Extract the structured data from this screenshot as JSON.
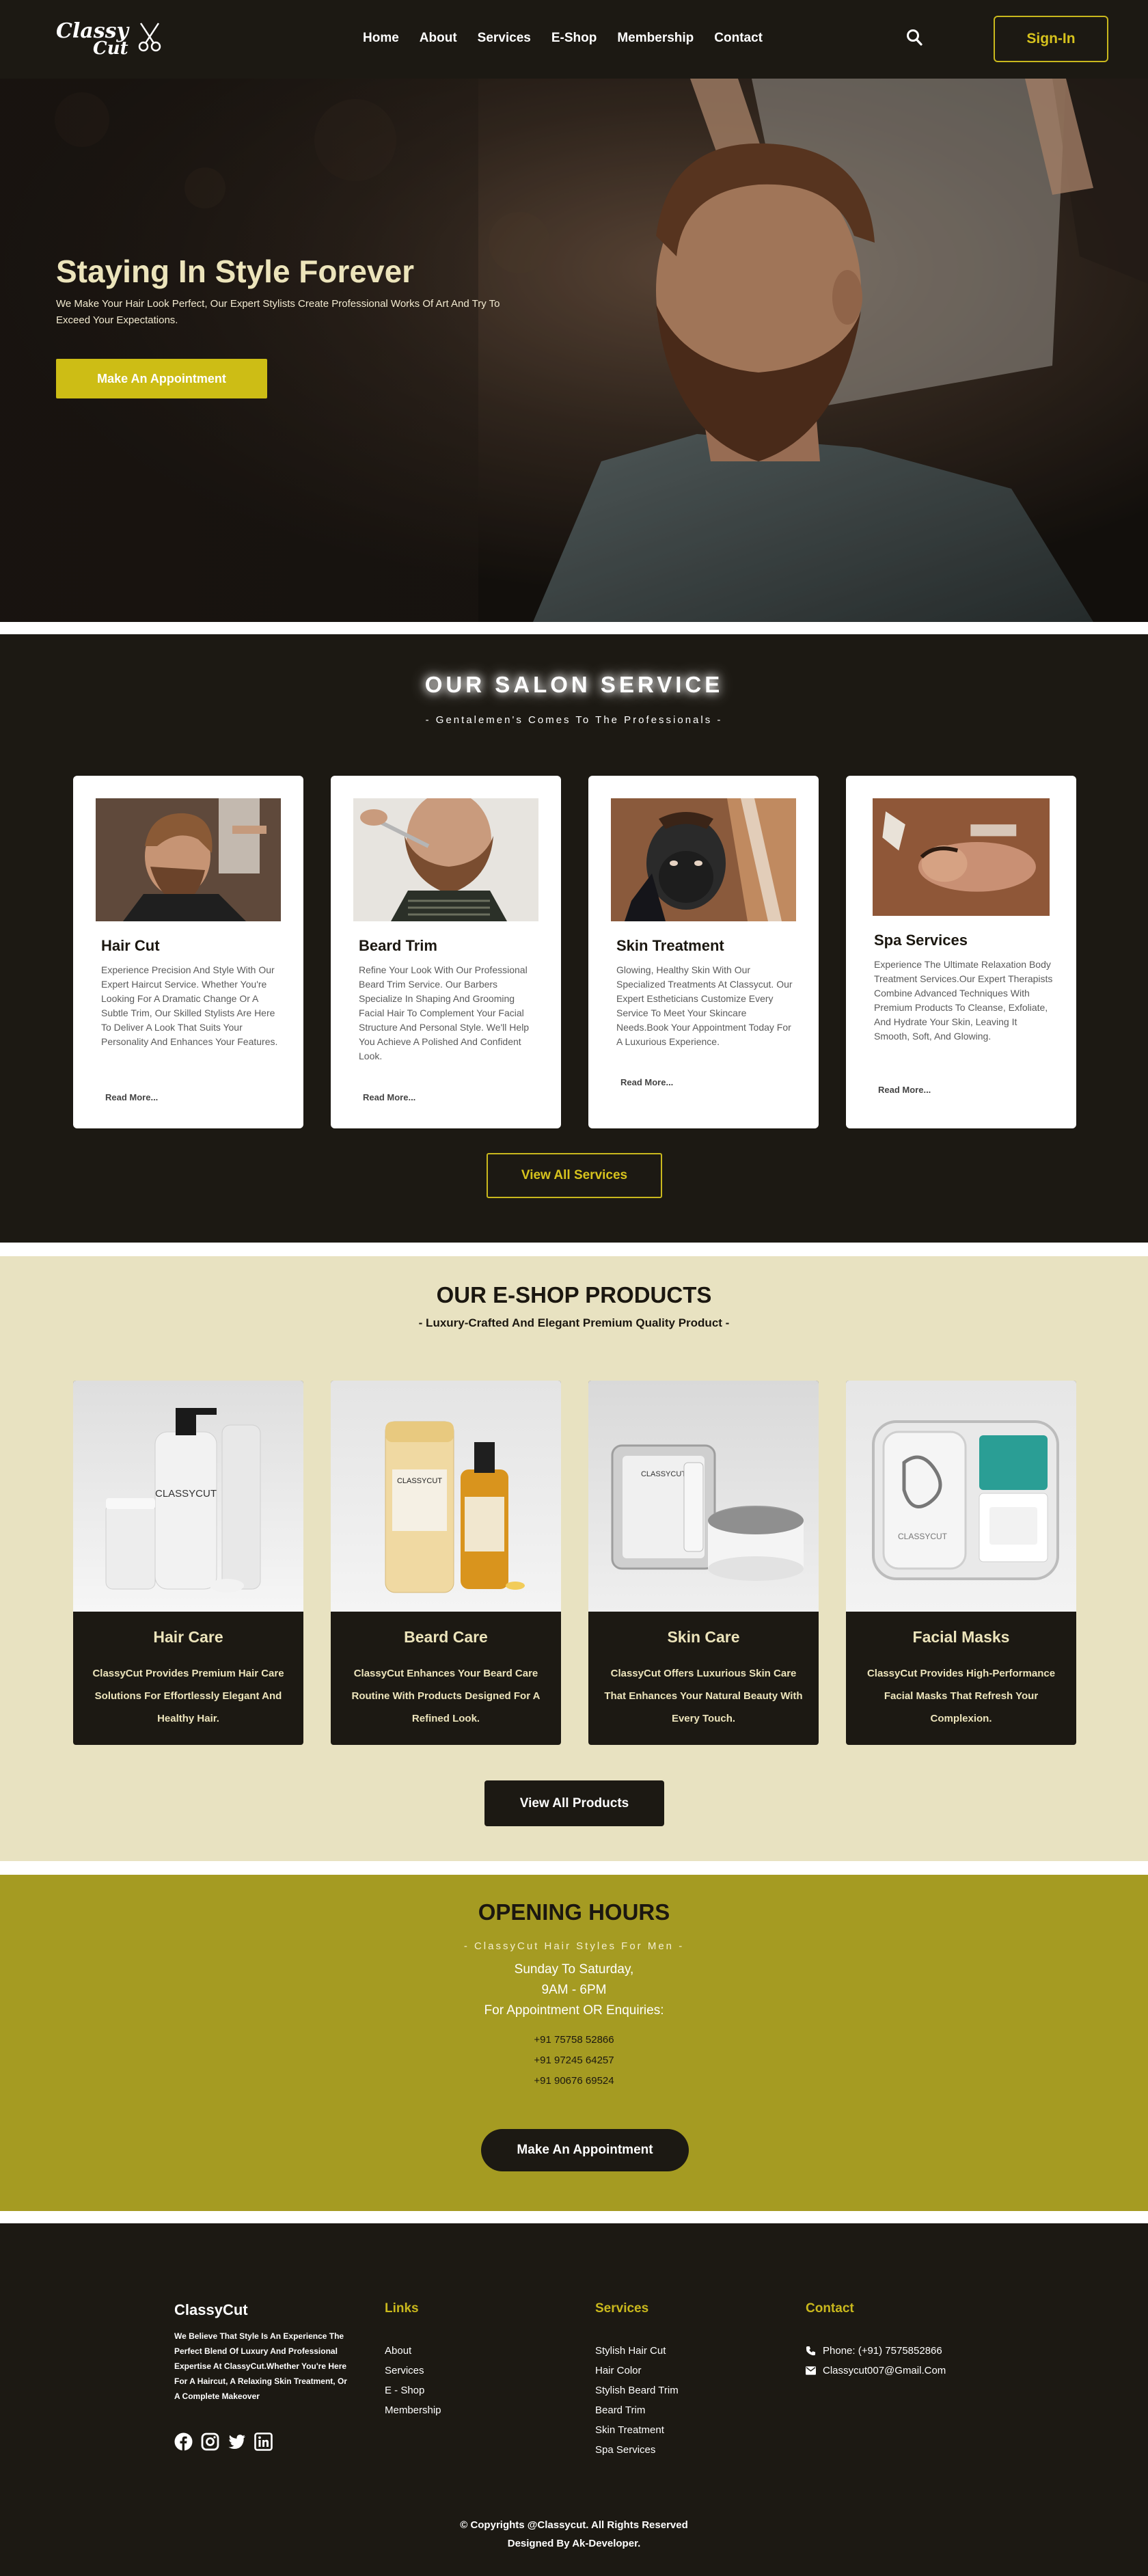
{
  "brand": {
    "logo_line1": "Classy",
    "logo_line2": "Cut"
  },
  "nav": {
    "links": [
      "Home",
      "About",
      "Services",
      "E-Shop",
      "Membership",
      "Contact"
    ],
    "signin_label": "Sign-In"
  },
  "hero": {
    "title": "Staying In Style Forever",
    "subtitle": "We Make Your Hair Look Perfect, Our Expert Stylists Create Professional Works Of Art And Try To Exceed Your Expectations.",
    "cta_label": "Make An Appointment"
  },
  "salon": {
    "title": "OUR SALON SERVICE",
    "subtitle": "- Gentalemen's Comes To The Professionals -",
    "cards": [
      {
        "title": "Hair Cut",
        "desc": "Experience Precision And Style With Our Expert Haircut Service. Whether You're Looking For A Dramatic Change Or A Subtle Trim, Our Skilled Stylists Are Here To Deliver A Look That Suits Your Personality And Enhances Your Features.",
        "more": "Read More..."
      },
      {
        "title": "Beard Trim",
        "desc": "Refine Your Look With Our Professional Beard Trim Service. Our Barbers Specialize In Shaping And Grooming Facial Hair To Complement Your Facial Structure And Personal Style. We'll Help You Achieve A Polished And Confident Look.",
        "more": "Read More..."
      },
      {
        "title": "Skin Treatment",
        "desc": "Glowing, Healthy Skin With Our Specialized Treatments At Classycut. Our Expert Estheticians Customize Every Service To Meet Your Skincare Needs.Book Your Appointment Today For A Luxurious Experience.",
        "more": "Read More..."
      },
      {
        "title": "Spa Services",
        "desc": "Experience The Ultimate Relaxation Body Treatment Services.Our Expert Therapists Combine Advanced Techniques With Premium Products To Cleanse, Exfoliate, And Hydrate Your Skin, Leaving It Smooth, Soft, And Glowing.",
        "more": "Read More..."
      }
    ],
    "view_all_label": "View All Services"
  },
  "eshop": {
    "title": "OUR E-SHOP PRODUCTS",
    "subtitle": "- Luxury-Crafted And Elegant Premium Quality Product -",
    "products": [
      {
        "title": "Hair Care",
        "desc": "ClassyCut Provides Premium Hair Care Solutions For Effortlessly Elegant And Healthy Hair.",
        "label": "CLASSYCUT"
      },
      {
        "title": "Beard Care",
        "desc": "ClassyCut Enhances Your Beard Care Routine With Products Designed For A Refined Look.",
        "label": "CLASSYCUT"
      },
      {
        "title": "Skin Care",
        "desc": "ClassyCut Offers Luxurious Skin Care That Enhances Your Natural Beauty With Every Touch.",
        "label": "CLASSYCUT"
      },
      {
        "title": "Facial Masks",
        "desc": "ClassyCut Provides High-Performance Facial Masks That Refresh Your Complexion.",
        "label": "CLASSYCUT"
      }
    ],
    "view_all_label": "View All Products"
  },
  "hours": {
    "title": "OPENING HOURS",
    "subtitle": "- ClassyCut Hair Styles For Men -",
    "days": "Sunday To Saturday,",
    "time": "9AM - 6PM",
    "enquiries": "For Appointment OR Enquiries:",
    "phones": [
      "+91 75758 52866",
      "+91 97245 64257",
      "+91 90676 69524"
    ],
    "cta_label": "Make An Appointment"
  },
  "footer": {
    "brand": "ClassyCut",
    "about": "We Believe That Style Is An Experience The Perfect Blend Of Luxury And Professional Expertise At ClassyCut.Whether You're Here For A Haircut, A Relaxing Skin Treatment, Or A Complete Makeover",
    "links_title": "Links",
    "links": [
      "About",
      "Services",
      "E - Shop",
      "Membership"
    ],
    "services_title": "Services",
    "services": [
      "Stylish Hair Cut",
      "Hair Color",
      "Stylish Beard Trim",
      "Beard Trim",
      "Skin Treatment",
      "Spa Services"
    ],
    "contact_title": "Contact",
    "phone": "Phone: (+91) 7575852866",
    "email": "Classycut007@Gmail.Com",
    "copyright": "© Copyrights @Classycut. All Rights Reserved",
    "designed_by": "Designed By Ak-Developer."
  },
  "colors": {
    "accent": "#cdbd15",
    "dark": "#1c1913",
    "cream": "#e8e2c1",
    "olive": "#a59b22"
  }
}
